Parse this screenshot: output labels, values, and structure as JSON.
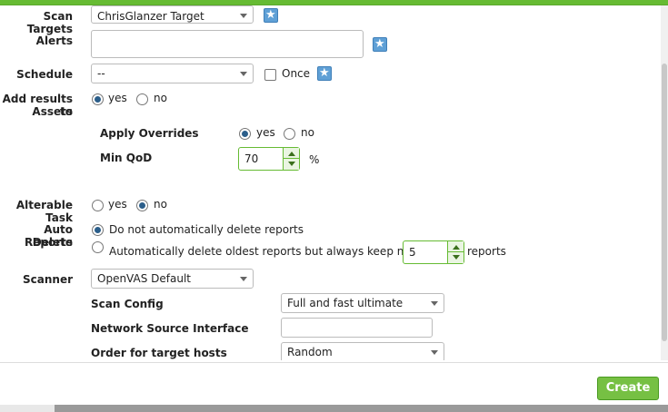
{
  "form": {
    "scan_targets": {
      "label": "Scan Targets",
      "value": "ChrisGlanzer Target"
    },
    "alerts": {
      "label": "Alerts"
    },
    "schedule": {
      "label": "Schedule",
      "value": "--",
      "once_label": "Once",
      "once_checked": false
    },
    "add_results": {
      "label_line1": "Add results to",
      "label_line2": "Assets",
      "yes": "yes",
      "no": "no",
      "selected": "yes"
    },
    "apply_overrides": {
      "label": "Apply Overrides",
      "yes": "yes",
      "no": "no",
      "selected": "yes"
    },
    "min_qod": {
      "label": "Min QoD",
      "value": "70",
      "unit": "%"
    },
    "alterable_task": {
      "label": "Alterable Task",
      "yes": "yes",
      "no": "no",
      "selected": "no"
    },
    "auto_delete": {
      "label_line1": "Auto Delete",
      "label_line2": "Reports",
      "option_no": "Do not automatically delete reports",
      "option_keep": "Automatically delete oldest reports but always keep newest",
      "keep_value": "5",
      "keep_unit": "reports",
      "selected": "no"
    },
    "scanner": {
      "label": "Scanner",
      "value": "OpenVAS Default"
    },
    "scan_config": {
      "label": "Scan Config",
      "value": "Full and fast ultimate"
    },
    "network_source_interface": {
      "label": "Network Source Interface",
      "value": ""
    },
    "order_target_hosts": {
      "label": "Order for target hosts",
      "value": "Random"
    }
  },
  "footer": {
    "create_label": "Create"
  },
  "colors": {
    "accent": "#66bb33",
    "button": "#76c043",
    "radio_on": "#2b5e8a",
    "star": "#5fa0d6"
  }
}
